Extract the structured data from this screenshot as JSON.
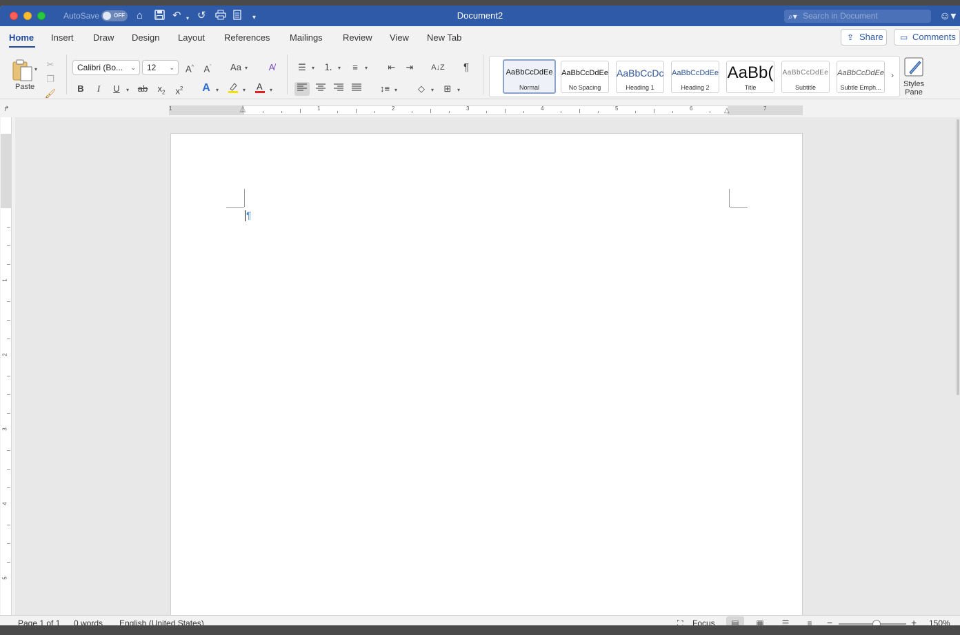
{
  "window": {
    "title": "Document2",
    "autosave_label": "AutoSave",
    "autosave_state": "OFF",
    "search_placeholder": "Search in Document"
  },
  "tabs": [
    "Home",
    "Insert",
    "Draw",
    "Design",
    "Layout",
    "References",
    "Mailings",
    "Review",
    "View",
    "New Tab"
  ],
  "active_tab": "Home",
  "actions": {
    "share": "Share",
    "comments": "Comments"
  },
  "clipboard": {
    "paste_label": "Paste"
  },
  "font": {
    "name": "Calibri (Bo...",
    "size": "12"
  },
  "style_preview_text": "AaBbCcDdEe",
  "title_preview_text": "AaBb(",
  "styles": [
    {
      "name": "Normal",
      "preview": "AaBbCcDdEe",
      "selected": true
    },
    {
      "name": "No Spacing",
      "preview": "AaBbCcDdEe",
      "selected": false
    },
    {
      "name": "Heading 1",
      "preview": "AaBbCcDc",
      "selected": false
    },
    {
      "name": "Heading 2",
      "preview": "AaBbCcDdEe",
      "selected": false
    },
    {
      "name": "Title",
      "preview": "AaBb(",
      "selected": false
    },
    {
      "name": "Subtitle",
      "preview": "AaBbCcDdEe",
      "selected": false
    },
    {
      "name": "Subtle Emph...",
      "preview": "AaBbCcDdEe",
      "selected": false
    }
  ],
  "styles_pane_label": [
    "Styles",
    "Pane"
  ],
  "ruler_numbers": [
    "1",
    "1",
    "2",
    "3",
    "4",
    "5",
    "6",
    "7"
  ],
  "vruler_numbers": [
    "1",
    "2",
    "3",
    "4",
    "5"
  ],
  "status": {
    "page": "Page 1 of 1",
    "words": "0 words",
    "language": "English (United States)",
    "focus": "Focus",
    "zoom": "150%"
  },
  "colors": {
    "titlebar": "#2e5aa8",
    "accent": "#1e4a9e",
    "highlight_yellow": "#f5e100",
    "font_red": "#e02020",
    "pilcrow": "#4f8fd6"
  }
}
